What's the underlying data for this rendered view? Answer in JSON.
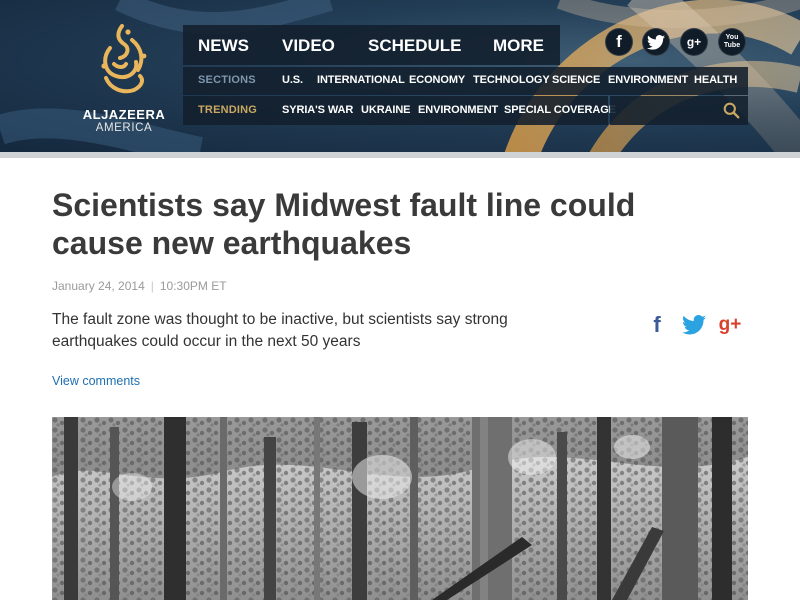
{
  "brand": {
    "name": "ALJAZEERA",
    "subname": "AMERICA",
    "logo_icon": "aljazeera-calligraphy-logo"
  },
  "main_nav": [
    {
      "label": "NEWS"
    },
    {
      "label": "VIDEO"
    },
    {
      "label": "SCHEDULE"
    },
    {
      "label": "MORE"
    }
  ],
  "social_top": [
    {
      "icon": "facebook-icon",
      "glyph": "f"
    },
    {
      "icon": "twitter-icon",
      "glyph": ""
    },
    {
      "icon": "google-plus-icon",
      "glyph": "g+"
    },
    {
      "icon": "youtube-icon",
      "glyph_top": "You",
      "glyph_bottom": "Tube"
    }
  ],
  "sections": {
    "label": "SECTIONS",
    "items": [
      "U.S.",
      "INTERNATIONAL",
      "ECONOMY",
      "TECHNOLOGY",
      "SCIENCE",
      "ENVIRONMENT",
      "HEALTH"
    ]
  },
  "trending": {
    "label": "TRENDING",
    "items": [
      "SYRIA'S WAR",
      "UKRAINE",
      "ENVIRONMENT",
      "SPECIAL COVERAGE"
    ]
  },
  "search": {
    "icon": "search-icon"
  },
  "article": {
    "headline_line1": "Scientists say Midwest fault line could",
    "headline_line2": "cause new earthquakes",
    "date": "January 24, 2014",
    "separator": "|",
    "time": "10:30PM ET",
    "dek_line1": "The fault zone was thought to be inactive, but scientists say strong",
    "dek_line2": "earthquakes could occur in the next 50 years",
    "view_comments": "View comments",
    "share": [
      {
        "icon": "facebook-share-icon",
        "glyph": "f"
      },
      {
        "icon": "twitter-share-icon",
        "glyph": ""
      },
      {
        "icon": "google-plus-share-icon",
        "glyph": "g+"
      }
    ]
  },
  "colors": {
    "header_bg": "#1f3a52",
    "nav_bg": "#121f2c",
    "sections_label": "#7f96ad",
    "trending_label": "#caa862",
    "link": "#1f6fb2",
    "facebook": "#3b5a9a",
    "twitter": "#2aa3e0",
    "google_plus": "#d9412f"
  }
}
